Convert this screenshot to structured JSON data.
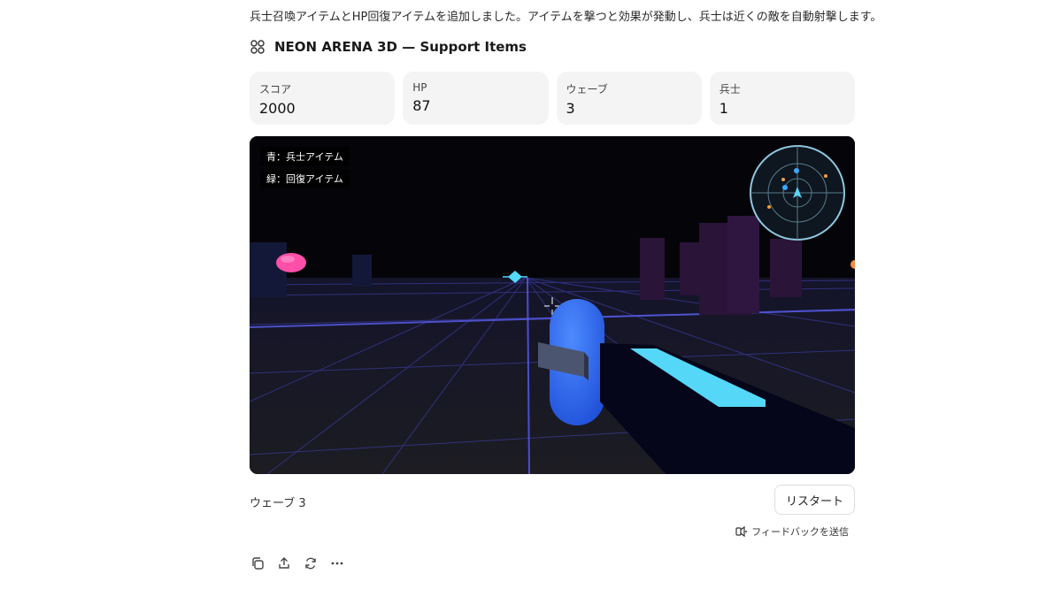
{
  "intro_text": "兵士召喚アイテムとHP回復アイテムを追加しました。アイテムを撃つと効果が発動し、兵士は近くの敵を自動射撃します。",
  "game_title": "NEON ARENA 3D — Support Items",
  "stats": [
    {
      "label": "スコア",
      "value": "2000"
    },
    {
      "label": "HP",
      "value": "87"
    },
    {
      "label": "ウェーブ",
      "value": "3"
    },
    {
      "label": "兵士",
      "value": "1"
    }
  ],
  "legend": {
    "blue": "青：兵士アイテム",
    "green": "緑：回復アイテム"
  },
  "wave_status": "ウェーブ 3",
  "restart_label": "リスタート",
  "feedback_label": "フィードバックを送信",
  "colors": {
    "soldier": "#2f6bf0",
    "beam": "#55d8f8",
    "enemy": "#ff4fa8",
    "grid": "#4b4fd8",
    "radar": "#8fc7e0"
  },
  "icons": {
    "title": "cube-cluster-icon",
    "copy": "copy-icon",
    "share": "share-icon",
    "retry": "retry-icon",
    "more": "more-icon",
    "feedback": "feedback-icon"
  }
}
